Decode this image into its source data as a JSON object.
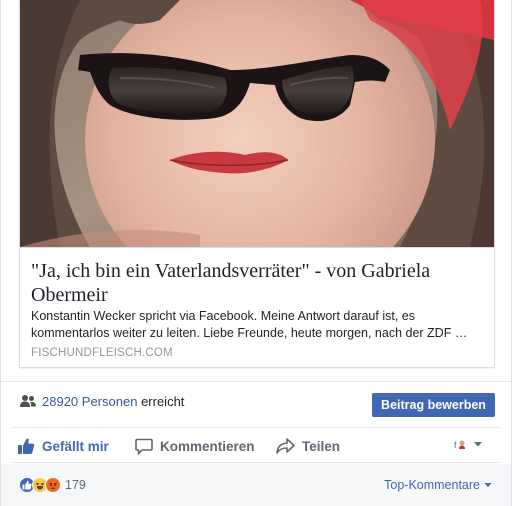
{
  "link_card": {
    "title": "\"Ja, ich bin ein Vaterlandsverräter\" - von Gabriela Obermeir",
    "description": "Konstantin Wecker spricht via Facebook. Meine Antwort darauf ist, es\nkommentarlos weiter zu leiten. Liebe Freunde, heute morgen, nach der ZDF …",
    "domain": "FISCHUNDFLEISCH.COM"
  },
  "reach": {
    "count": "28920",
    "people_label": "Personen",
    "suffix": "erreicht",
    "boost_label": "Beitrag bewerben"
  },
  "actions": {
    "like_label": "Gefällt mir",
    "comment_label": "Kommentieren",
    "share_label": "Teilen"
  },
  "reactions": {
    "types": [
      "like-icon",
      "haha-icon",
      "angry-icon"
    ],
    "count": "179",
    "sort_label": "Top-Kommentare"
  },
  "colors": {
    "facebook_blue": "#4267b2",
    "link_blue": "#365899",
    "muted_text": "#90949c",
    "action_gray": "#606770"
  }
}
